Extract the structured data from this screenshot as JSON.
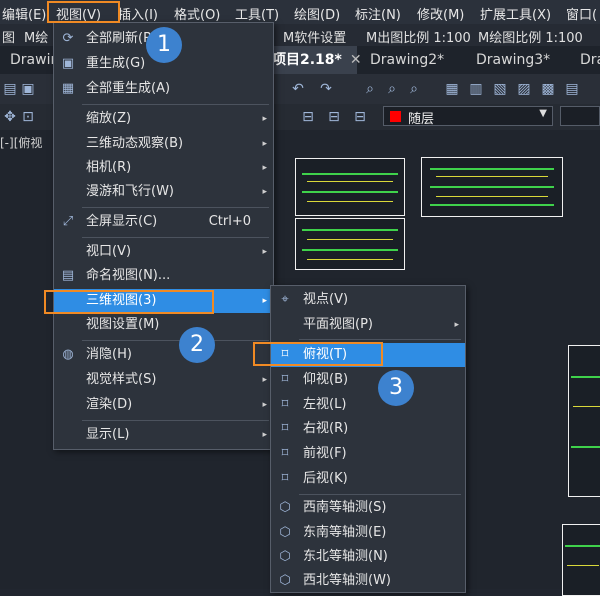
{
  "menubar": {
    "items": [
      "编辑(E)",
      "视图(V)",
      "插入(I)",
      "格式(O)",
      "工具(T)",
      "绘图(D)",
      "标注(N)",
      "修改(M)",
      "扩展工具(X)",
      "窗口("
    ]
  },
  "strip2": {
    "items": [
      "图",
      "M绘",
      "M软件设置",
      "M出图比例 1:100",
      "M绘图比例 1:100"
    ]
  },
  "tabs": {
    "items": [
      "Drawin",
      "项目2.18*",
      "Drawing2*",
      "Drawing3*",
      "Dra"
    ],
    "close": "✕"
  },
  "toolbar": {
    "layer": "随层",
    "view_label": "[-][俯视"
  },
  "view_menu": {
    "items": [
      {
        "label": "全部刷新(R)",
        "icon": "refresh-icon"
      },
      {
        "label": "重生成(G)",
        "icon": "regen-icon"
      },
      {
        "label": "全部重生成(A)",
        "icon": "regen-all-icon"
      },
      {
        "label": "缩放(Z)",
        "submenu": "▸"
      },
      {
        "label": "三维动态观察(B)",
        "submenu": "▸"
      },
      {
        "label": "相机(R)",
        "submenu": "▸"
      },
      {
        "label": "漫游和飞行(W)",
        "submenu": "▸"
      },
      {
        "label": "全屏显示(C)",
        "shortcut": "Ctrl+0",
        "icon": "fullscreen-icon"
      },
      {
        "label": "视口(V)",
        "submenu": "▸"
      },
      {
        "label": "命名视图(N)...",
        "icon": "named-view-icon"
      },
      {
        "label": "三维视图(3)",
        "submenu": "▸"
      },
      {
        "label": "视图设置(M)"
      },
      {
        "label": "消隐(H)",
        "icon": "hide-icon"
      },
      {
        "label": "视觉样式(S)",
        "submenu": "▸"
      },
      {
        "label": "渲染(D)",
        "submenu": "▸"
      },
      {
        "label": "显示(L)",
        "submenu": "▸"
      }
    ]
  },
  "sub_menu": {
    "items": [
      {
        "label": "视点(V)",
        "icon": "viewpoint-icon"
      },
      {
        "label": "平面视图(P)",
        "submenu": "▸"
      },
      {
        "label": "俯视(T)",
        "icon": "top-view-icon"
      },
      {
        "label": "仰视(B)",
        "icon": "bottom-view-icon"
      },
      {
        "label": "左视(L)",
        "icon": "left-view-icon"
      },
      {
        "label": "右视(R)",
        "icon": "right-view-icon"
      },
      {
        "label": "前视(F)",
        "icon": "front-view-icon"
      },
      {
        "label": "后视(K)",
        "icon": "back-view-icon"
      },
      {
        "label": "西南等轴测(S)",
        "icon": "sw-iso-icon"
      },
      {
        "label": "东南等轴测(E)",
        "icon": "se-iso-icon"
      },
      {
        "label": "东北等轴测(N)",
        "icon": "ne-iso-icon"
      },
      {
        "label": "西北等轴测(W)",
        "icon": "nw-iso-icon"
      }
    ]
  },
  "badges": [
    "1",
    "2",
    "3"
  ],
  "colors": {
    "highlight": "#2f8de4",
    "annotation": "#f08a24",
    "badge": "#3d82cf"
  }
}
